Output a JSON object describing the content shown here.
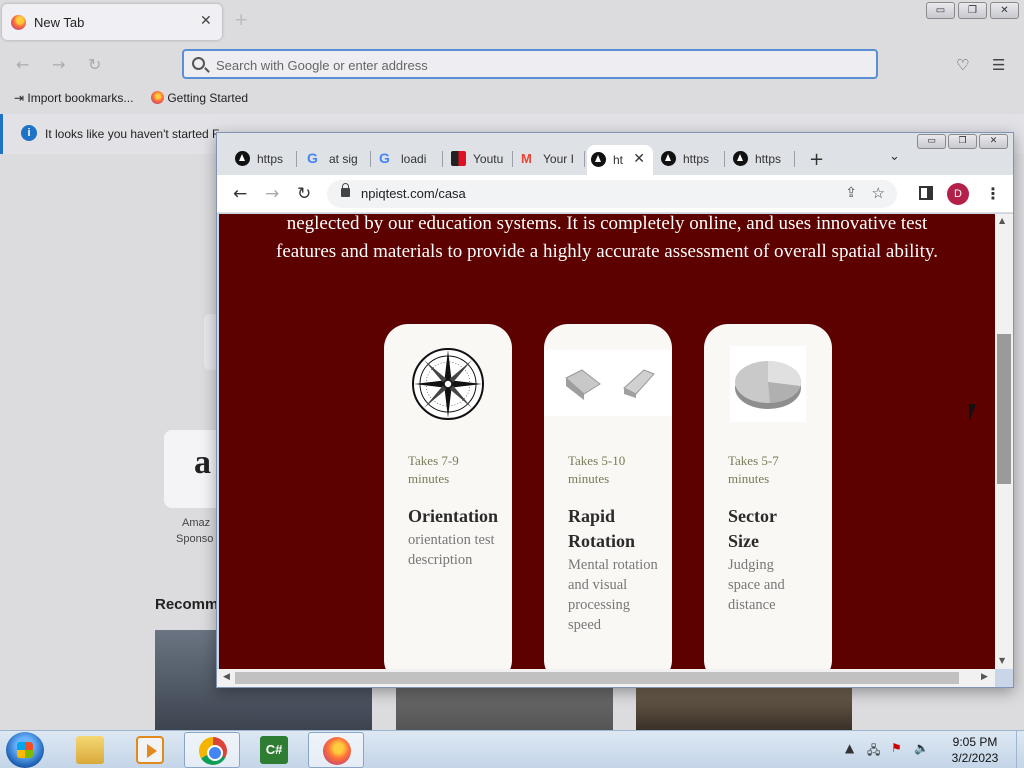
{
  "firefox": {
    "tab_title": "New Tab",
    "url_placeholder": "Search with Google or enter address",
    "bookmarks": [
      "Import bookmarks...",
      "Getting Started"
    ],
    "notice": "It looks like you haven't started F",
    "tile_label": "Amaz",
    "tile_sponsor": "Sponso",
    "recommended": "Recomm"
  },
  "chrome": {
    "tabs": [
      {
        "label": "https",
        "favicon": "triangle-logo-icon"
      },
      {
        "label": "at sig",
        "favicon": "google-icon"
      },
      {
        "label": "loadi",
        "favicon": "google-icon"
      },
      {
        "label": "Youtu",
        "favicon": "document-icon"
      },
      {
        "label": "Your I",
        "favicon": "gmail-icon"
      },
      {
        "label": "ht",
        "favicon": "triangle-logo-icon",
        "active": true
      },
      {
        "label": "https",
        "favicon": "triangle-logo-icon"
      },
      {
        "label": "https",
        "favicon": "triangle-logo-icon"
      }
    ],
    "url": "npiqtest.com/casa",
    "avatar_letter": "D"
  },
  "page": {
    "intro_line1": "neglected by our education systems. It is completely online, and uses innovative test",
    "intro_line2": "features and materials to provide a highly accurate assessment of overall spatial ability.",
    "cards": [
      {
        "takes": "Takes 7-9 minutes",
        "name": "Orientation",
        "desc": "orientation test description",
        "image": "compass-icon"
      },
      {
        "takes": "Takes 5-10 minutes",
        "name": "Rapid Rotation",
        "desc": "Mental rotation and visual processing speed",
        "image": "rotation-shapes-icon"
      },
      {
        "takes": "Takes 5-7 minutes",
        "name": "Sector Size",
        "desc": "Judging space and distance",
        "image": "pie-chart-icon"
      }
    ],
    "background_color": "#5c0000"
  },
  "taskbar": {
    "time": "9:05 PM",
    "date": "3/2/2023"
  }
}
